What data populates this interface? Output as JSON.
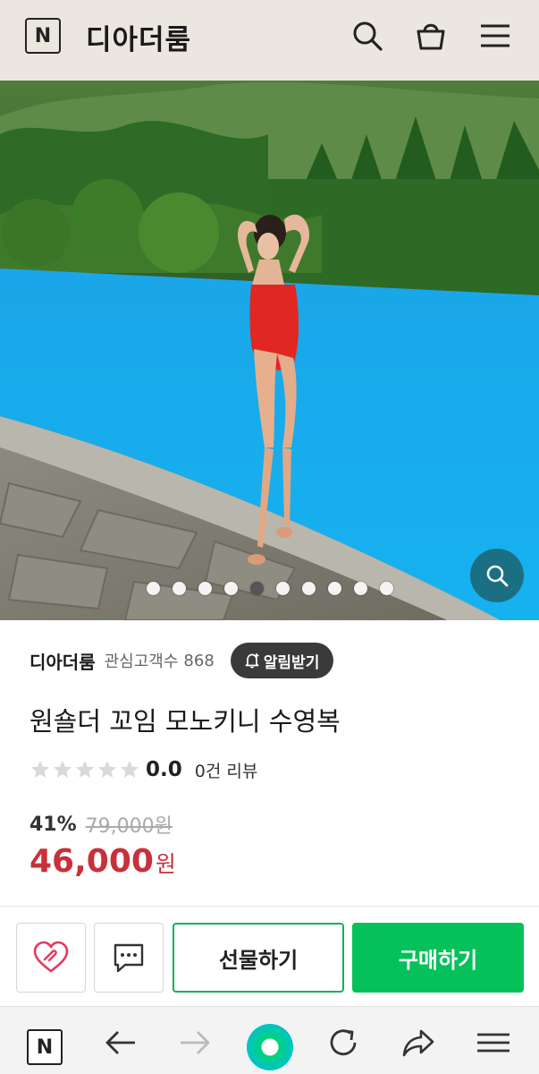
{
  "header": {
    "logo_letter": "N",
    "store_name": "디아더룸",
    "icons": [
      "search-icon",
      "shopping-bag-icon",
      "menu-icon"
    ]
  },
  "gallery": {
    "total_images": 10,
    "active_index": 5,
    "zoom_icon": "magnifier-icon"
  },
  "seller": {
    "name": "디아더룸",
    "fans_label": "관심고객수",
    "fans_count": "868",
    "alarm_label": "알림받기"
  },
  "product": {
    "title": "원숄더 꼬임 모노키니 수영복",
    "rating": "0.0",
    "review_count": "0건 리뷰",
    "stars_filled": 0,
    "stars_total": 5,
    "discount_rate": "41%",
    "original_price": "79,000원",
    "sale_price": "46,000",
    "currency": "원"
  },
  "actions": {
    "wishlist_icon": "heart-icon",
    "chat_icon": "chat-bubble-icon",
    "gift_label": "선물하기",
    "buy_label": "구매하기"
  },
  "browser_nav": {
    "logo_letter": "N",
    "icons": [
      "back-arrow-icon",
      "forward-arrow-icon",
      "home-orb-icon",
      "refresh-icon",
      "share-icon",
      "menu-icon"
    ]
  },
  "colors": {
    "header_bg": "#ece6e1",
    "price_red": "#c8313a",
    "buy_green": "#06c15a",
    "zoom_teal": "#1b6f82"
  }
}
